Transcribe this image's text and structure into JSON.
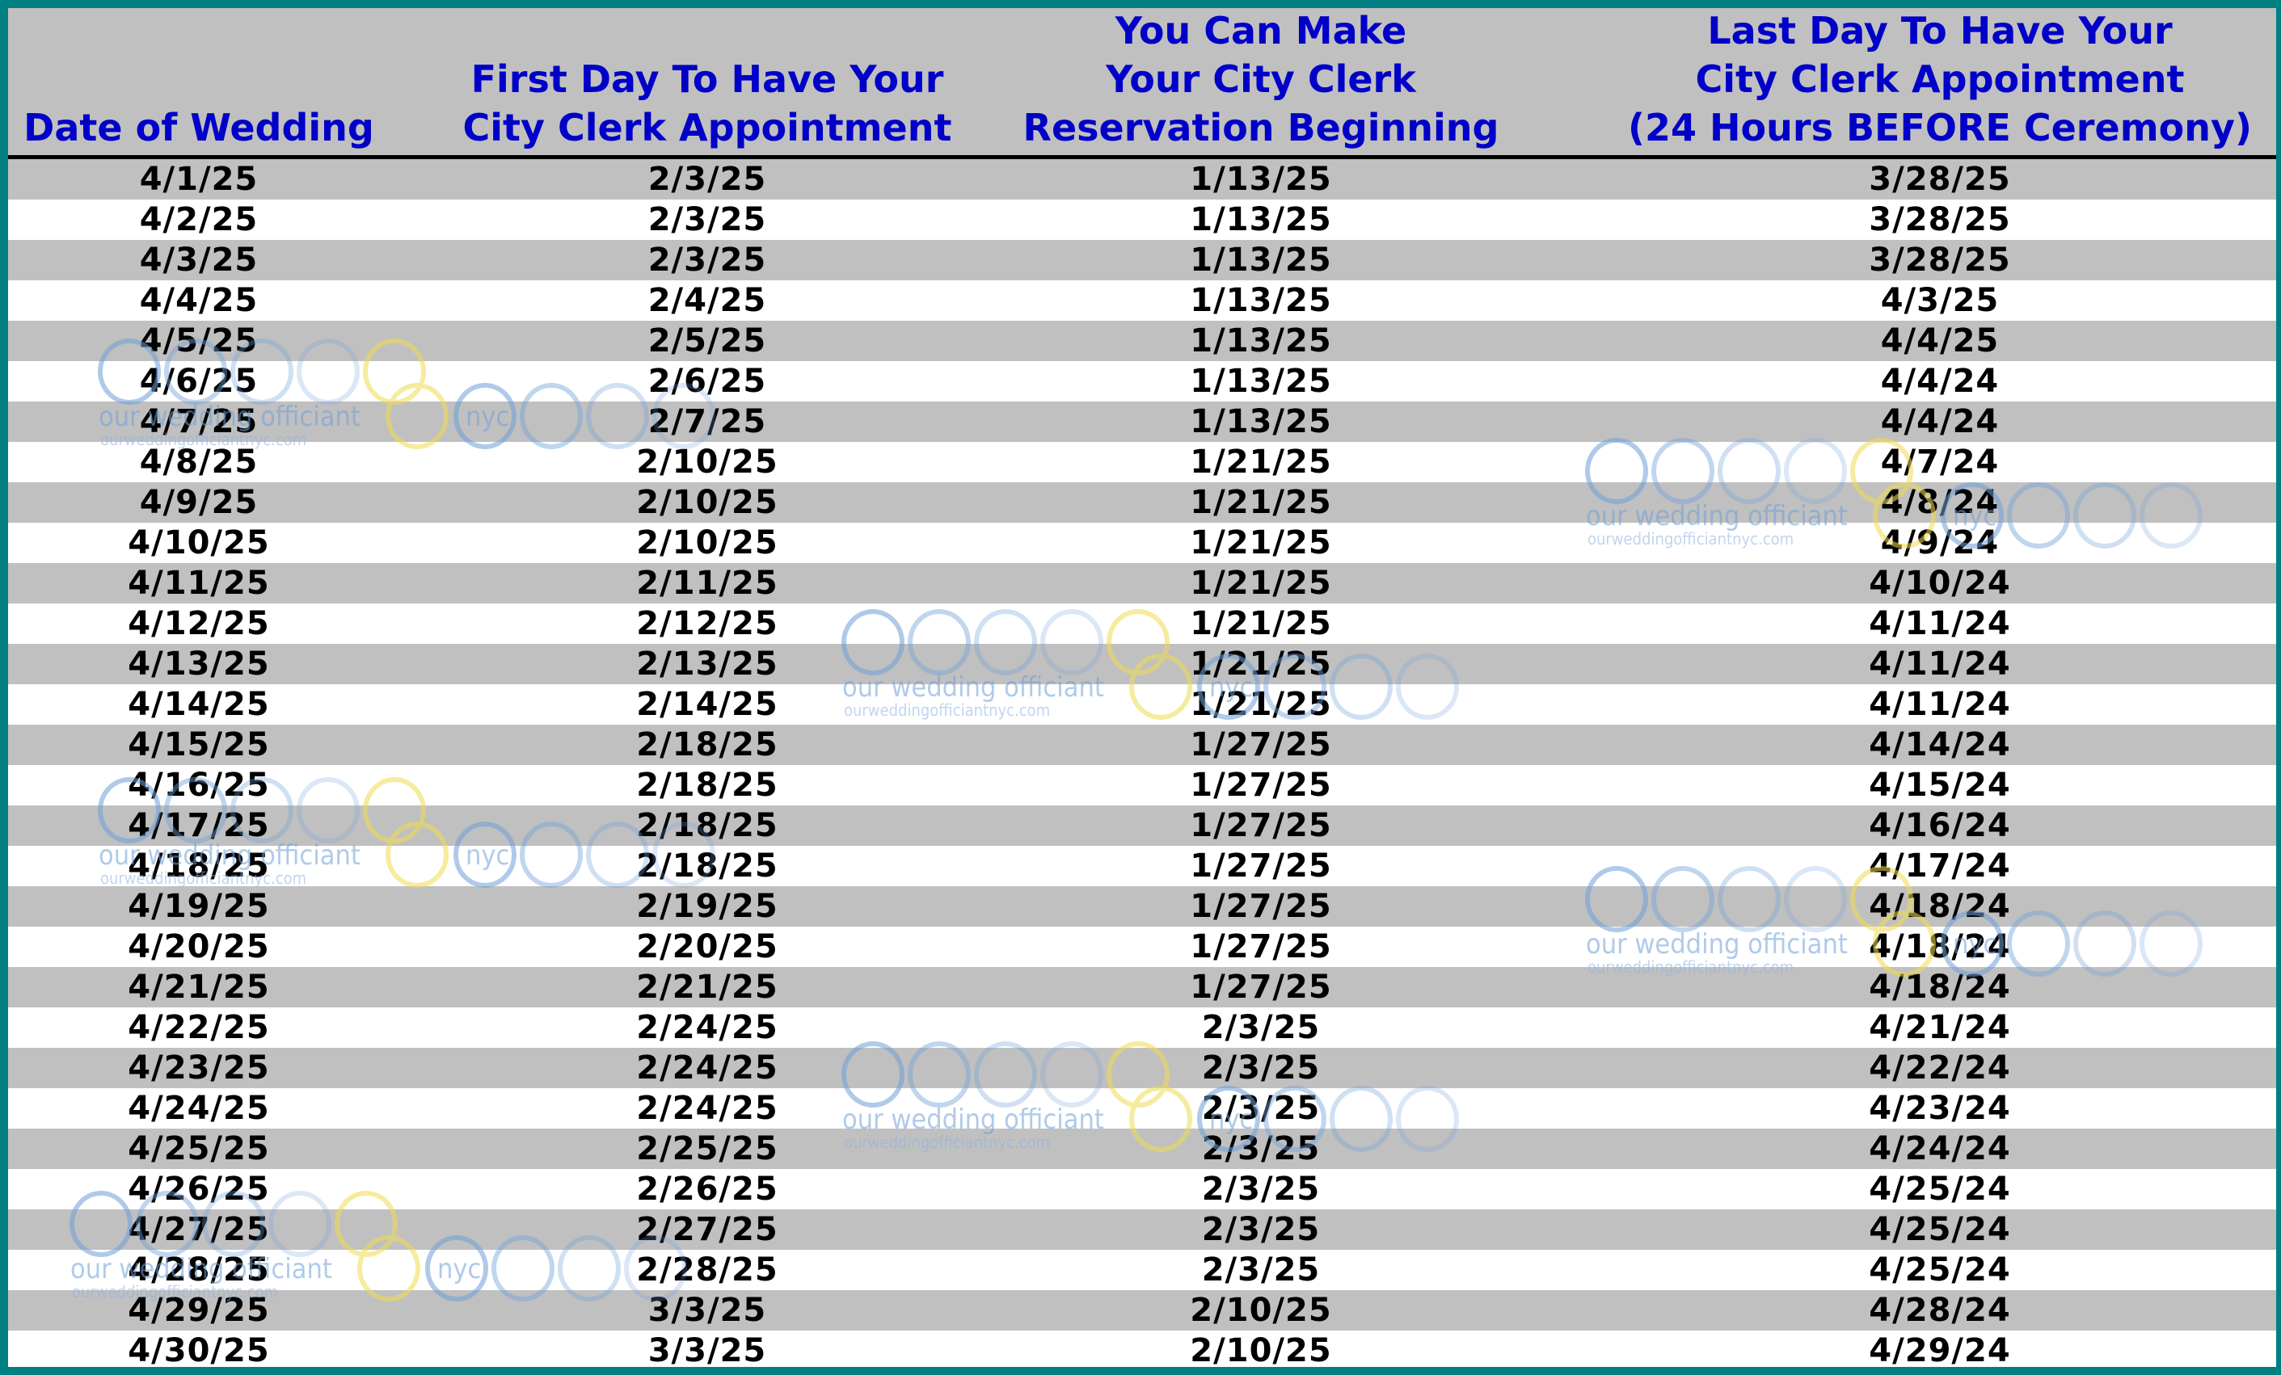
{
  "header": {
    "columns": [
      {
        "lines": [
          "Date of Wedding"
        ]
      },
      {
        "lines": [
          "First Day To Have Your",
          "City Clerk Appointment"
        ]
      },
      {
        "lines": [
          "You Can Make",
          "Your City Clerk",
          "Reservation Beginning"
        ]
      },
      {
        "lines": [
          "Last Day To Have Your",
          "City Clerk Appointment",
          "(24 Hours BEFORE Ceremony)"
        ]
      }
    ]
  },
  "rows": [
    [
      "4/1/25",
      "2/3/25",
      "1/13/25",
      "3/28/25"
    ],
    [
      "4/2/25",
      "2/3/25",
      "1/13/25",
      "3/28/25"
    ],
    [
      "4/3/25",
      "2/3/25",
      "1/13/25",
      "3/28/25"
    ],
    [
      "4/4/25",
      "2/4/25",
      "1/13/25",
      "4/3/25"
    ],
    [
      "4/5/25",
      "2/5/25",
      "1/13/25",
      "4/4/25"
    ],
    [
      "4/6/25",
      "2/6/25",
      "1/13/25",
      "4/4/24"
    ],
    [
      "4/7/25",
      "2/7/25",
      "1/13/25",
      "4/4/24"
    ],
    [
      "4/8/25",
      "2/10/25",
      "1/21/25",
      "4/7/24"
    ],
    [
      "4/9/25",
      "2/10/25",
      "1/21/25",
      "4/8/24"
    ],
    [
      "4/10/25",
      "2/10/25",
      "1/21/25",
      "4/9/24"
    ],
    [
      "4/11/25",
      "2/11/25",
      "1/21/25",
      "4/10/24"
    ],
    [
      "4/12/25",
      "2/12/25",
      "1/21/25",
      "4/11/24"
    ],
    [
      "4/13/25",
      "2/13/25",
      "1/21/25",
      "4/11/24"
    ],
    [
      "4/14/25",
      "2/14/25",
      "1/21/25",
      "4/11/24"
    ],
    [
      "4/15/25",
      "2/18/25",
      "1/27/25",
      "4/14/24"
    ],
    [
      "4/16/25",
      "2/18/25",
      "1/27/25",
      "4/15/24"
    ],
    [
      "4/17/25",
      "2/18/25",
      "1/27/25",
      "4/16/24"
    ],
    [
      "4/18/25",
      "2/18/25",
      "1/27/25",
      "4/17/24"
    ],
    [
      "4/19/25",
      "2/19/25",
      "1/27/25",
      "4/18/24"
    ],
    [
      "4/20/25",
      "2/20/25",
      "1/27/25",
      "4/18/24"
    ],
    [
      "4/21/25",
      "2/21/25",
      "1/27/25",
      "4/18/24"
    ],
    [
      "4/22/25",
      "2/24/25",
      "2/3/25",
      "4/21/24"
    ],
    [
      "4/23/25",
      "2/24/25",
      "2/3/25",
      "4/22/24"
    ],
    [
      "4/24/25",
      "2/24/25",
      "2/3/25",
      "4/23/24"
    ],
    [
      "4/25/25",
      "2/25/25",
      "2/3/25",
      "4/24/24"
    ],
    [
      "4/26/25",
      "2/26/25",
      "2/3/25",
      "4/25/24"
    ],
    [
      "4/27/25",
      "2/27/25",
      "2/3/25",
      "4/25/24"
    ],
    [
      "4/28/25",
      "2/28/25",
      "2/3/25",
      "4/25/24"
    ],
    [
      "4/29/25",
      "3/3/25",
      "2/10/25",
      "4/28/24"
    ],
    [
      "4/30/25",
      "3/3/25",
      "2/10/25",
      "4/29/24"
    ]
  ],
  "watermark": {
    "brand": "our wedding officiant",
    "suffix": "nyc",
    "url": "ourweddingofficiantnyc.com"
  },
  "colors": {
    "frame": "#008080",
    "header_text": "#0000c8",
    "band_gray": "#c0c0c0",
    "band_white": "#ffffff",
    "ring_blue": "#6fa0d8",
    "ring_yellow": "#f0dc50"
  }
}
